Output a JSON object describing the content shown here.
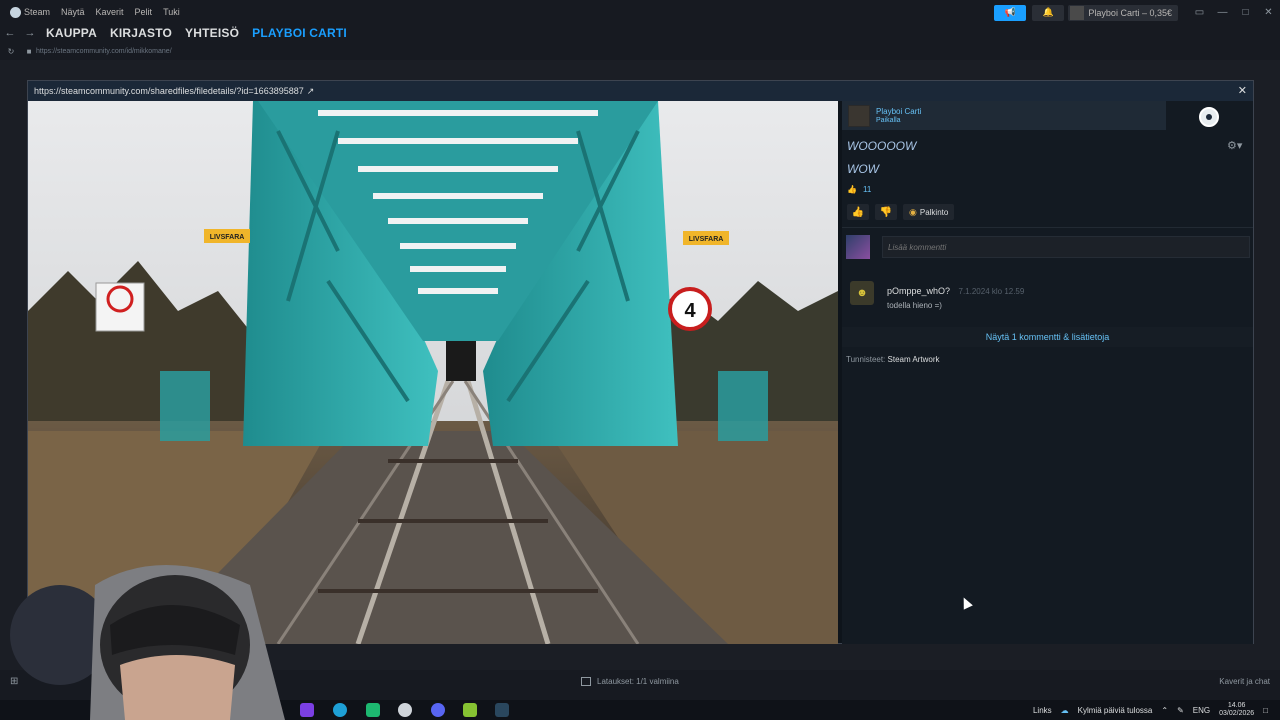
{
  "menubar": {
    "items": [
      "Steam",
      "Näytä",
      "Kaverit",
      "Pelit",
      "Tuki"
    ],
    "account_name": "Playboi Carti",
    "balance": "0,35€"
  },
  "nav": {
    "tabs": [
      "KAUPPA",
      "KIRJASTO",
      "YHTEISÖ",
      "PLAYBOI CARTI"
    ],
    "url": "https://steamcommunity.com/id/mikkomane/"
  },
  "modal": {
    "url": "https://steamcommunity.com/sharedfiles/filedetails/?id=1663895887",
    "author": {
      "name": "Playboi Carti",
      "status": "Paikalla"
    },
    "title_line1": "WOOOOOW",
    "title_line2": "WOW",
    "rating_count": "11",
    "award_label": "Palkinto",
    "comment_placeholder": "Lisää kommentti",
    "comment": {
      "user": "pOmppe_whO?",
      "time": "7.1.2024 klo 12.59",
      "text": "todella hieno =)"
    },
    "more_link": "Näytä 1 kommentti & lisätietoja",
    "tags_label": "Tunnisteet:",
    "tags_value": "Steam Artwork",
    "artwork_signs": {
      "left": "LIVSFARA",
      "right": "LIVSFARA",
      "speed": "4"
    }
  },
  "status": {
    "downloads": "Lataukset: 1/1 valmiina",
    "friends": "Kaverit ja chat"
  },
  "taskbar": {
    "links": "Links",
    "weather": "Kylmiä päiviä tulossa",
    "lang": "ENG",
    "time": "14.06",
    "date": "03/02/2026"
  },
  "colors": {
    "accent": "#1a9fff",
    "link": "#66c0f4",
    "bridge": "#2aa8a8"
  }
}
